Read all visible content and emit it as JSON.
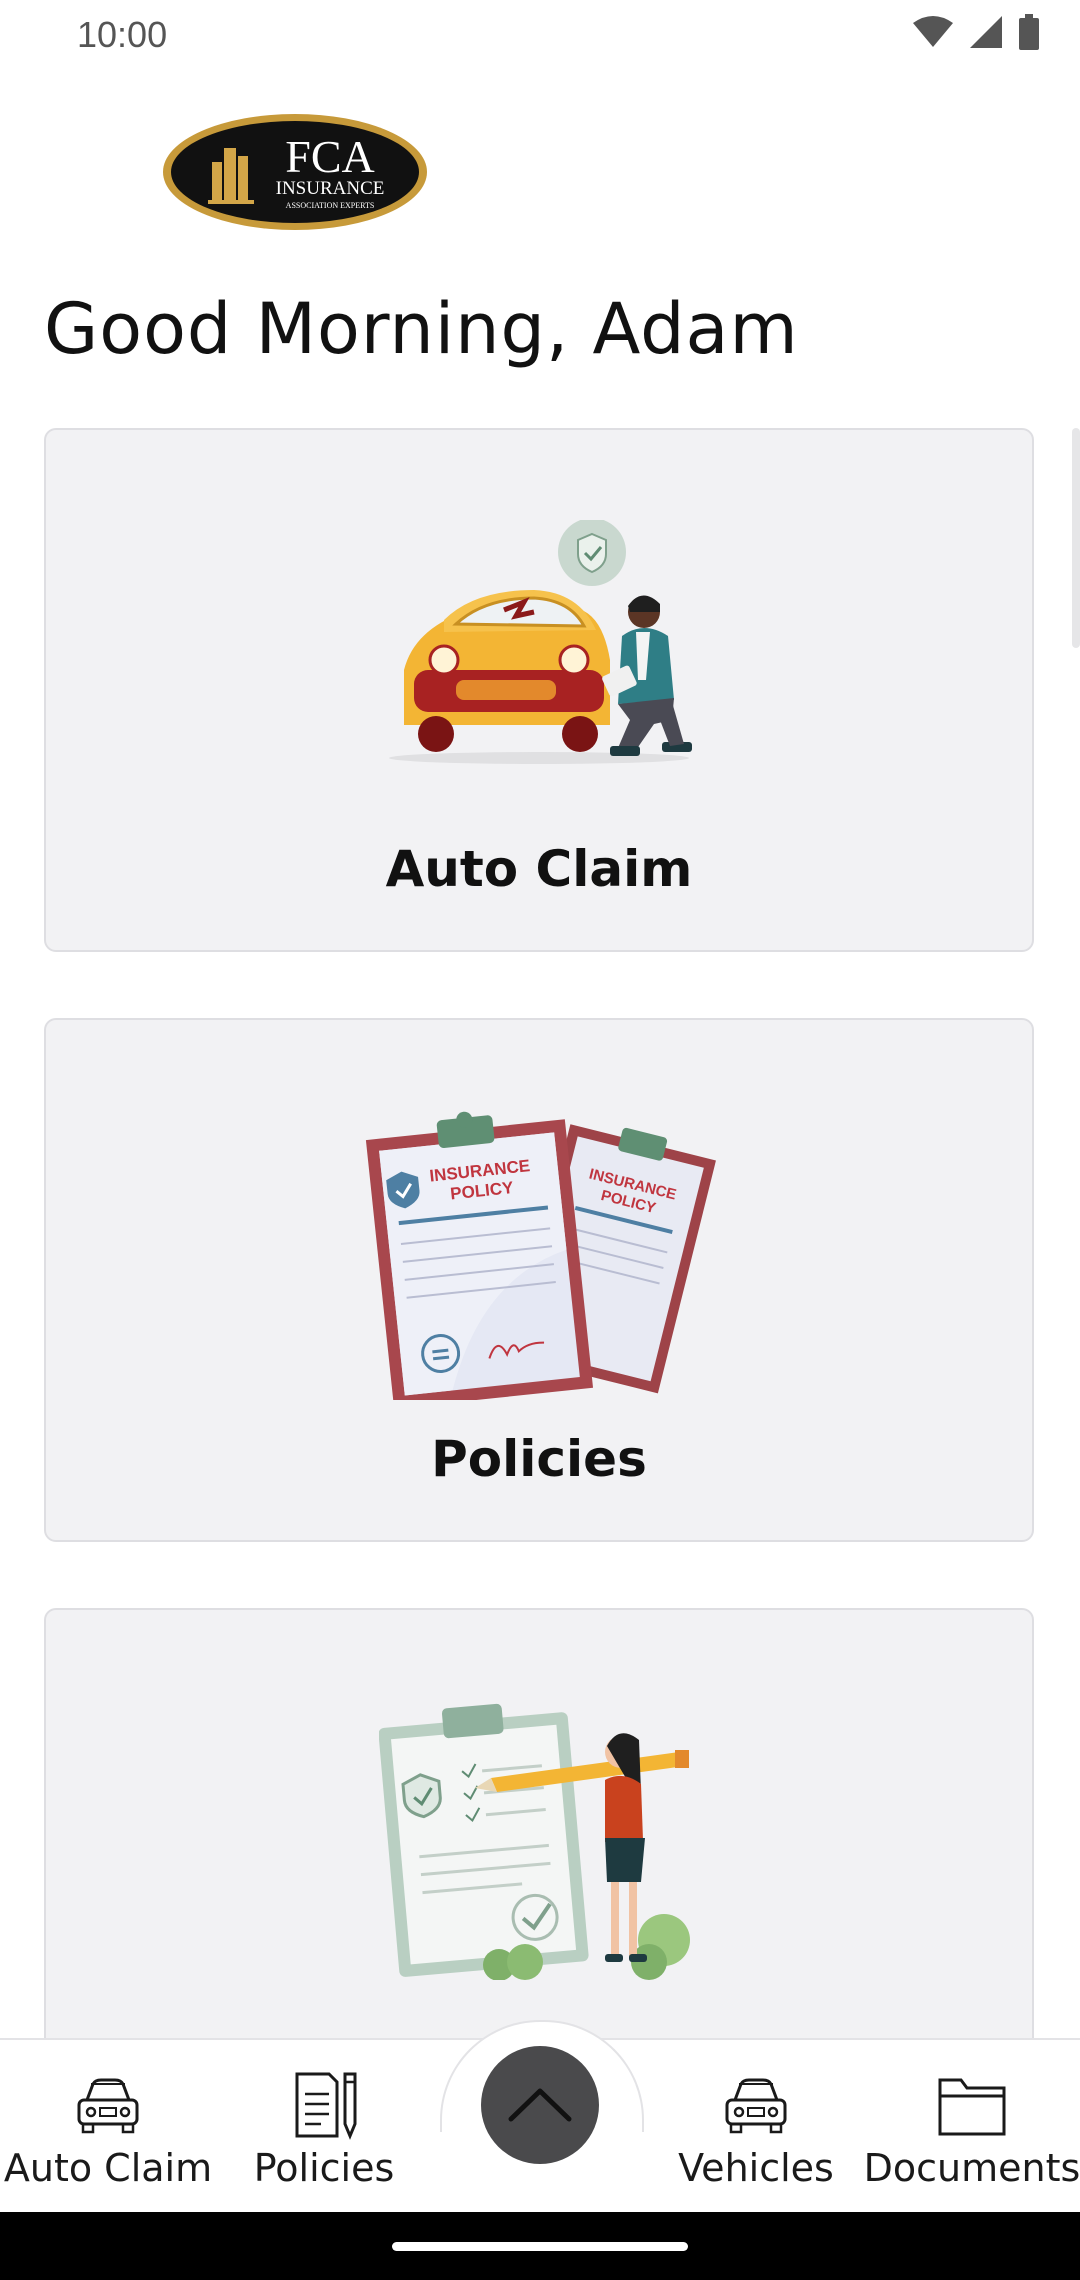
{
  "status_bar": {
    "time": "10:00",
    "icons": [
      "wifi-icon",
      "signal-icon",
      "battery-icon"
    ]
  },
  "logo": {
    "brand": "FCA",
    "line1": "INSURANCE",
    "line2": "ASSOCIATION EXPERTS"
  },
  "greeting": "Good Morning, Adam",
  "cards": [
    {
      "label": "Auto Claim",
      "illustration": "car-damage-inspection-illustration"
    },
    {
      "label": "Policies",
      "illustration": "insurance-policy-documents-illustration"
    },
    {
      "label": "",
      "illustration": "checklist-clipboard-woman-illustration"
    }
  ],
  "policy_doc_text": "INSURANCE POLICY",
  "bottom_nav": {
    "items": [
      {
        "label": "Auto Claim",
        "icon": "car-icon"
      },
      {
        "label": "Policies",
        "icon": "document-pen-icon"
      },
      {
        "label": "Vehicles",
        "icon": "car-icon"
      },
      {
        "label": "Documents",
        "icon": "folder-icon"
      }
    ],
    "center_button_icon": "chevron-up-icon"
  },
  "colors": {
    "card_bg": "#f2f2f4",
    "center_button": "#4a4a4c",
    "car_yellow": "#f5b73b",
    "policy_red": "#c0353f"
  }
}
